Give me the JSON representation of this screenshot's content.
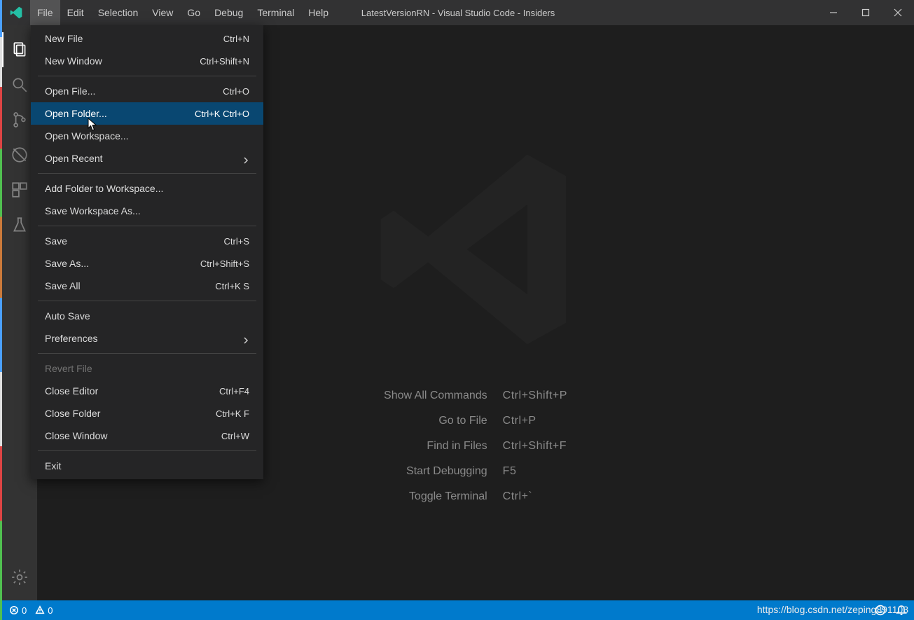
{
  "window": {
    "title": "LatestVersionRN - Visual Studio Code - Insiders"
  },
  "menubar": {
    "items": [
      "File",
      "Edit",
      "Selection",
      "View",
      "Go",
      "Debug",
      "Terminal",
      "Help"
    ],
    "active_index": 0
  },
  "dropdown": {
    "groups": [
      [
        {
          "label": "New File",
          "accel": "Ctrl+N"
        },
        {
          "label": "New Window",
          "accel": "Ctrl+Shift+N"
        }
      ],
      [
        {
          "label": "Open File...",
          "accel": "Ctrl+O"
        },
        {
          "label": "Open Folder...",
          "accel": "Ctrl+K Ctrl+O",
          "hover": true
        },
        {
          "label": "Open Workspace...",
          "accel": ""
        },
        {
          "label": "Open Recent",
          "accel": "",
          "submenu": true
        }
      ],
      [
        {
          "label": "Add Folder to Workspace...",
          "accel": ""
        },
        {
          "label": "Save Workspace As...",
          "accel": ""
        }
      ],
      [
        {
          "label": "Save",
          "accel": "Ctrl+S"
        },
        {
          "label": "Save As...",
          "accel": "Ctrl+Shift+S"
        },
        {
          "label": "Save All",
          "accel": "Ctrl+K S"
        }
      ],
      [
        {
          "label": "Auto Save",
          "accel": ""
        },
        {
          "label": "Preferences",
          "accel": "",
          "submenu": true
        }
      ],
      [
        {
          "label": "Revert File",
          "accel": "",
          "disabled": true
        },
        {
          "label": "Close Editor",
          "accel": "Ctrl+F4"
        },
        {
          "label": "Close Folder",
          "accel": "Ctrl+K F"
        },
        {
          "label": "Close Window",
          "accel": "Ctrl+W"
        }
      ],
      [
        {
          "label": "Exit",
          "accel": ""
        }
      ]
    ]
  },
  "hints": [
    {
      "label": "Show All Commands",
      "key": "Ctrl+Shift+P"
    },
    {
      "label": "Go to File",
      "key": "Ctrl+P"
    },
    {
      "label": "Find in Files",
      "key": "Ctrl+Shift+F"
    },
    {
      "label": "Start Debugging",
      "key": "F5"
    },
    {
      "label": "Toggle Terminal",
      "key": "Ctrl+`"
    }
  ],
  "statusbar": {
    "errors": "0",
    "warnings": "0"
  },
  "watermark_url": "https://blog.csdn.net/zeping891103"
}
